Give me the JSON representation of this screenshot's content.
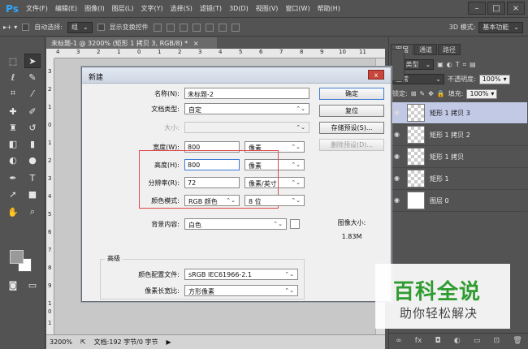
{
  "app": {
    "logo": "Ps",
    "menu": [
      "文件(F)",
      "编辑(E)",
      "图像(I)",
      "图层(L)",
      "文字(Y)",
      "选择(S)",
      "滤镜(T)",
      "3D(D)",
      "视图(V)",
      "窗口(W)",
      "帮助(H)"
    ],
    "win_controls": [
      "–",
      "□",
      "×"
    ]
  },
  "options": {
    "auto_select_label": "自动选择:",
    "auto_select_value": "组",
    "show_transform_label": "显示变换控件",
    "mode_3d_label": "3D 模式:",
    "workspace": "基本功能"
  },
  "document": {
    "tab_title": "未标题-1 @ 3200% (矩形 1 拷贝 3, RGB/8) *",
    "tab_close": "×",
    "ruler_top": [
      "4",
      "3",
      "2",
      "1",
      "0",
      "1",
      "2",
      "3",
      "4",
      "5",
      "6",
      "7",
      "8",
      "9",
      "10",
      "11"
    ],
    "ruler_left": [
      "3",
      "2",
      "1",
      "0",
      "1",
      "2",
      "3",
      "4",
      "5",
      "6",
      "7",
      "8",
      "9",
      "1",
      "0",
      "1"
    ],
    "zoom": "3200%",
    "doc_info": "文档:192 字节/0 字节"
  },
  "layers_panel": {
    "tabs": [
      "图层",
      "通道",
      "路径"
    ],
    "kind_filter": "类型",
    "blend_mode": "正常",
    "opacity_label": "不透明度:",
    "opacity_value": "100%",
    "lock_label": "锁定:",
    "fill_label": "填充:",
    "fill_value": "100%",
    "layers": [
      {
        "name": "矩形 1 拷贝 3",
        "selected": true
      },
      {
        "name": "矩形 1 拷贝 2",
        "selected": false
      },
      {
        "name": "矩形 1 拷贝",
        "selected": false
      },
      {
        "name": "矩形 1",
        "selected": false
      },
      {
        "name": "图层 0",
        "selected": false
      }
    ],
    "footer_icons": [
      "link-icon",
      "fx-icon",
      "mask-icon",
      "adjustment-icon",
      "folder-icon",
      "new-layer-icon",
      "trash-icon"
    ]
  },
  "dialog": {
    "title": "新建",
    "close": "x",
    "name_label": "名称(N):",
    "name_value": "未标题-2",
    "doc_type_label": "文档类型:",
    "doc_type_value": "自定",
    "size_label": "大小:",
    "width_label": "宽度(W):",
    "width_value": "800",
    "width_unit": "像素",
    "height_label": "高度(H):",
    "height_value": "800",
    "height_unit": "像素",
    "resolution_label": "分辨率(R):",
    "resolution_value": "72",
    "resolution_unit": "像素/英寸",
    "color_mode_label": "颜色模式:",
    "color_mode_value": "RGB 颜色",
    "bit_depth_value": "8 位",
    "bg_label": "背景内容:",
    "bg_value": "白色",
    "advanced_label": "高级",
    "color_profile_label": "颜色配置文件:",
    "color_profile_value": "sRGB IEC61966-2.1",
    "pixel_aspect_label": "像素长宽比:",
    "pixel_aspect_value": "方形像素",
    "ok_label": "确定",
    "reset_label": "复位",
    "save_preset_label": "存储预设(S)...",
    "delete_preset_label": "删除预设(D)...",
    "image_size_label": "图像大小:",
    "image_size_value": "1.83M"
  },
  "watermark": {
    "title": "百科全说",
    "subtitle": "助你轻松解决"
  }
}
